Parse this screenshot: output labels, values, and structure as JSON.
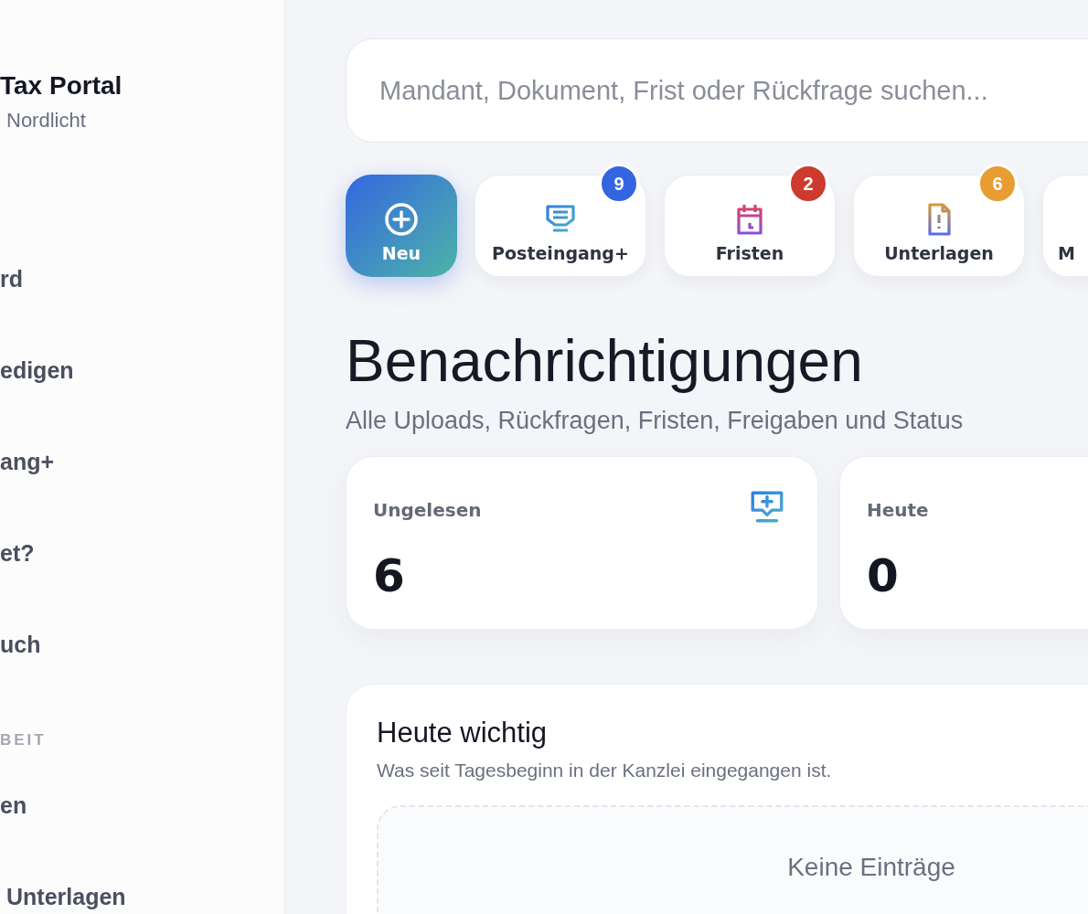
{
  "sidebar": {
    "brand": {
      "title": "Tax Portal",
      "subtitle": "Nordlicht"
    },
    "items": [
      {
        "label": "rd"
      },
      {
        "label": "edigen"
      },
      {
        "label": "ang+"
      },
      {
        "label": "et?"
      },
      {
        "label": "uch"
      }
    ],
    "section_label": "BEIT",
    "section_items": [
      {
        "label": "en"
      },
      {
        "label": "Unterlagen"
      }
    ]
  },
  "search": {
    "placeholder": "Mandant, Dokument, Frist oder Rückfrage suchen..."
  },
  "quick_actions": [
    {
      "kind": "new",
      "label": "Neu"
    },
    {
      "kind": "inbox",
      "label": "Posteingang+",
      "badge": "9",
      "color": "#3465e0"
    },
    {
      "kind": "deadline",
      "label": "Fristen",
      "badge": "2",
      "color": "#cc3b2e"
    },
    {
      "kind": "document",
      "label": "Unterlagen",
      "badge": "6",
      "color": "#e89c32"
    },
    {
      "kind": "other",
      "label": "M"
    }
  ],
  "page": {
    "title": "Benachrichtigungen",
    "subtitle": "Alle Uploads, Rückfragen, Fristen, Freigaben und Status"
  },
  "stats": [
    {
      "kind": "inbox",
      "label": "Ungelesen",
      "value": "6"
    },
    {
      "kind": "plain",
      "label": "Heute",
      "value": "0"
    }
  ],
  "panel": {
    "title": "Heute wichtig",
    "subtitle": "Was seit Tagesbeginn in der Kanzlei eingegangen ist.",
    "empty_text": "Keine Einträge"
  }
}
